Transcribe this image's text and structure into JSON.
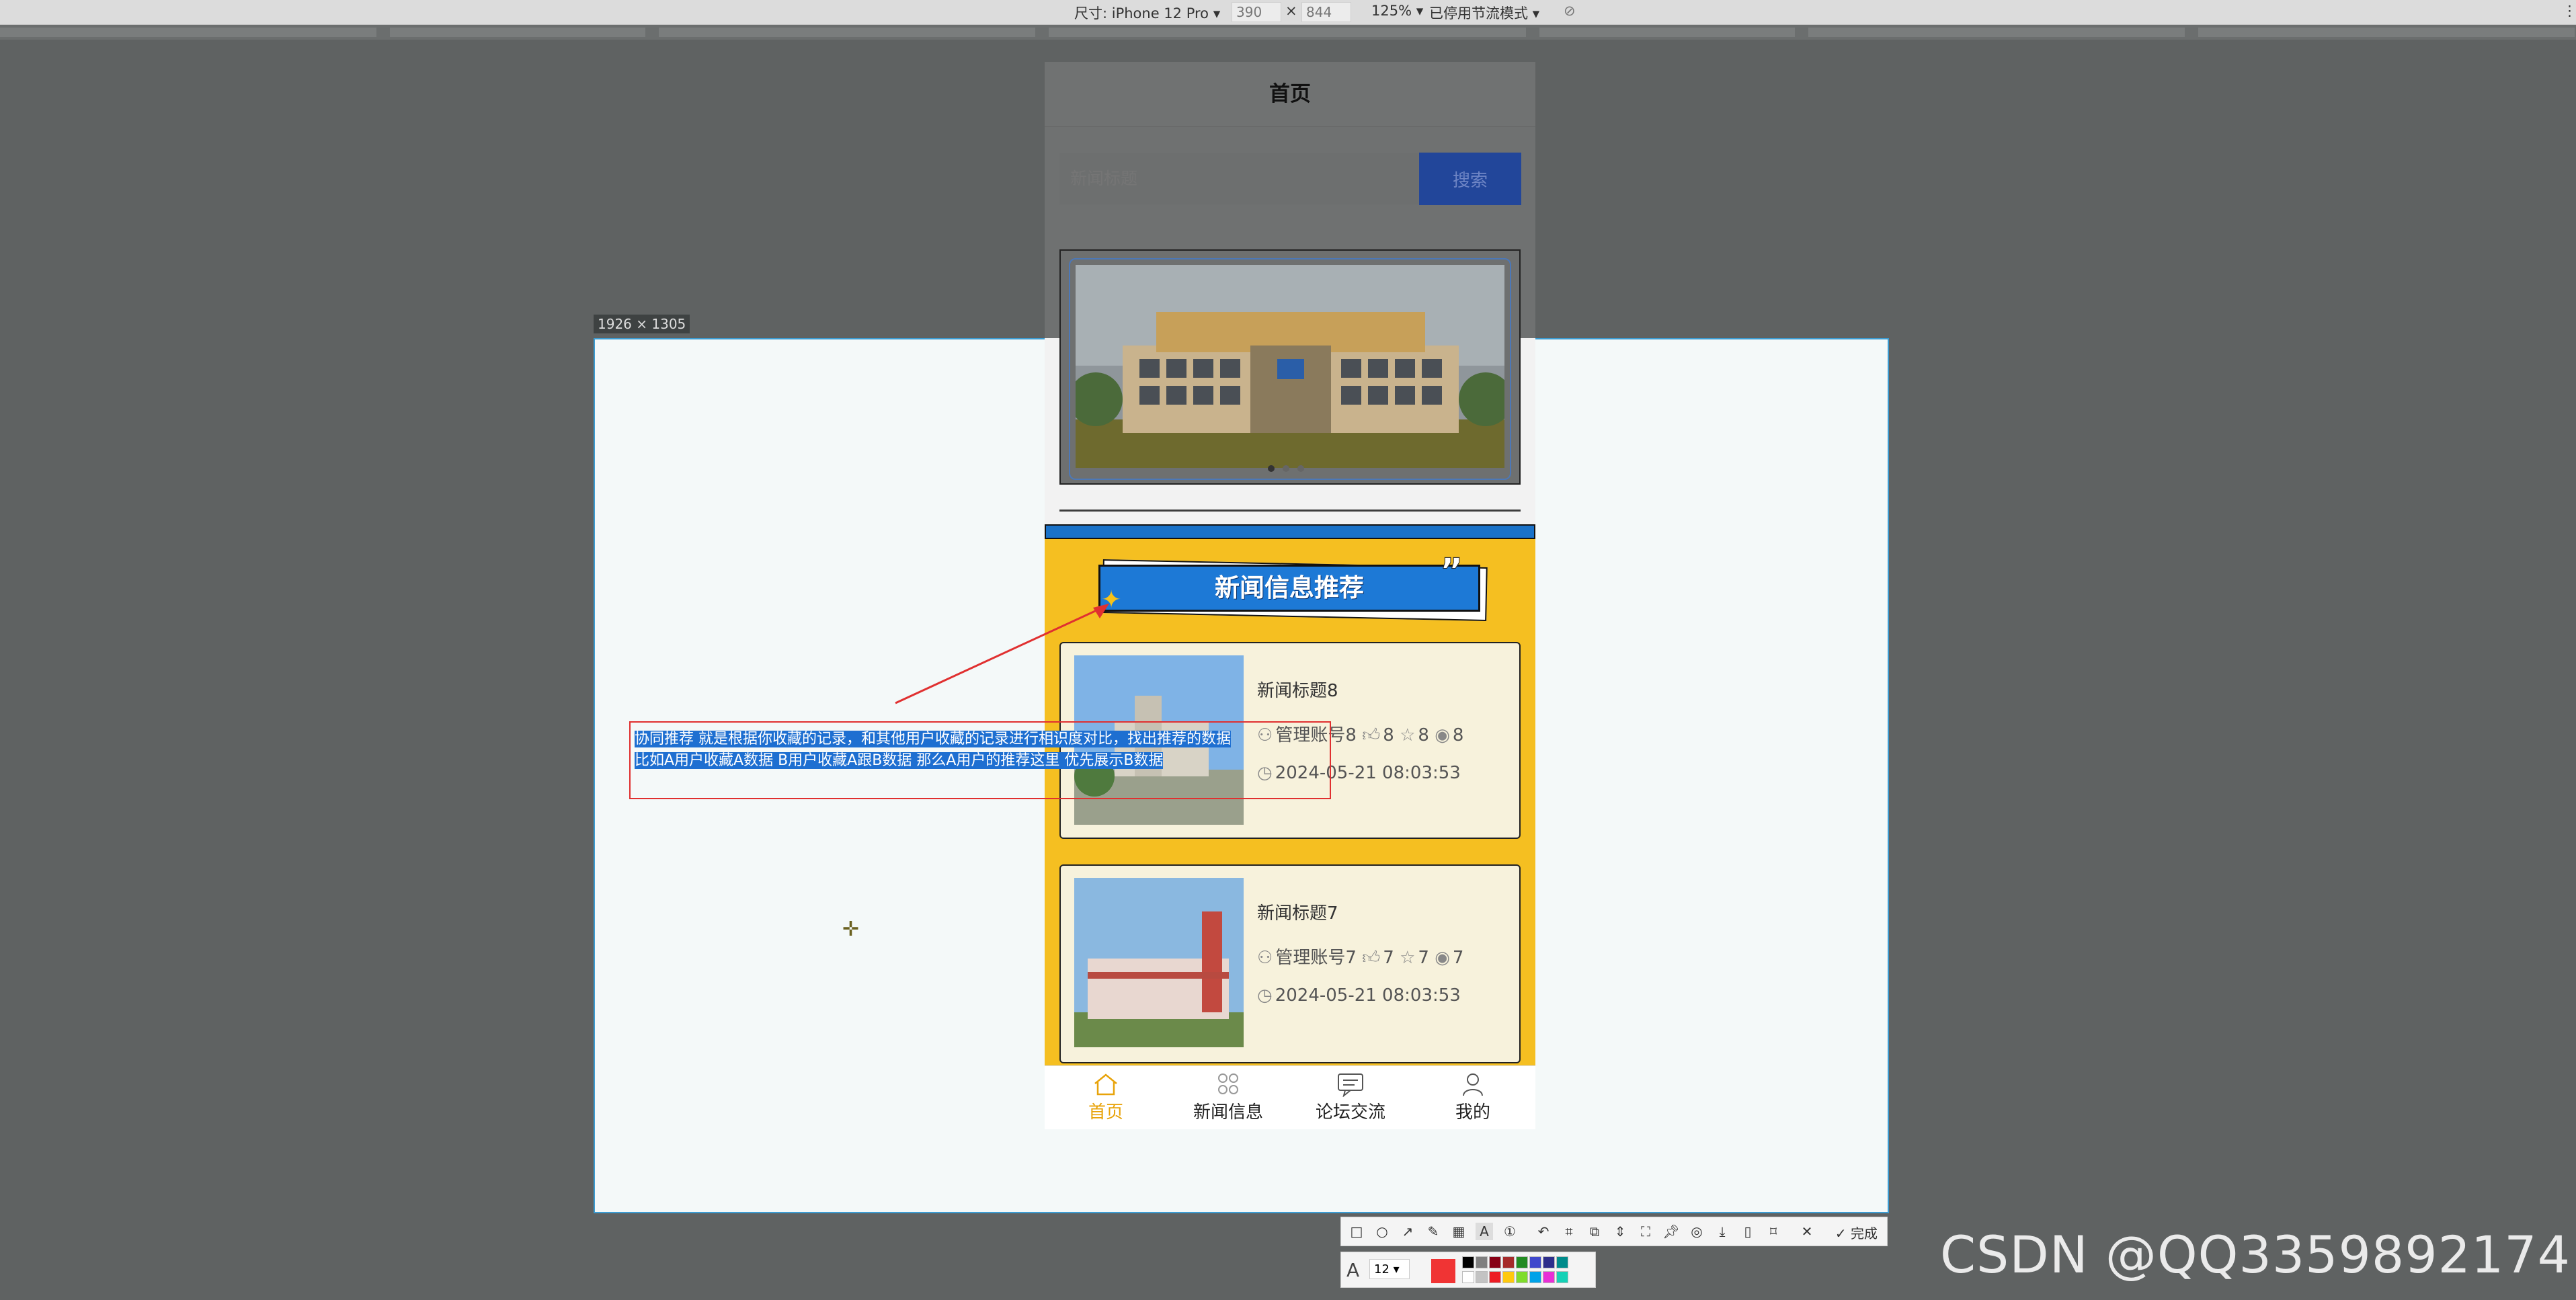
{
  "devtools": {
    "device": "尺寸: iPhone 12 Pro ▾",
    "width": "390",
    "times": "×",
    "height": "844",
    "zoom": "125% ▾",
    "throttle": "已停用节流模式 ▾"
  },
  "selection": {
    "size_label": "1926 × 1305"
  },
  "page": {
    "title": "首页",
    "search": {
      "placeholder": "新闻标题",
      "button": "搜索"
    },
    "recommend_title": "新闻信息推荐",
    "recommend_quote": "”",
    "news": [
      {
        "title": "新闻标题8",
        "author": "管理账号8",
        "likes": "8",
        "favorites": "8",
        "views": "8",
        "time": "2024-05-21 08:03:53"
      },
      {
        "title": "新闻标题7",
        "author": "管理账号7",
        "likes": "7",
        "favorites": "7",
        "views": "7",
        "time": "2024-05-21 08:03:53"
      }
    ],
    "tabs": [
      {
        "label": "首页",
        "icon": "home-icon",
        "active": true
      },
      {
        "label": "新闻信息",
        "icon": "grid-icon",
        "active": false
      },
      {
        "label": "论坛交流",
        "icon": "chat-icon",
        "active": false
      },
      {
        "label": "我的",
        "icon": "user-icon",
        "active": false
      }
    ]
  },
  "annotation": {
    "line1": "协同推荐  就是根据你收藏的记录，和其他用户收藏的记录进行相识度对比，找出推荐的数据",
    "line2": "比如A用户收藏A数据 B用户收藏A跟B数据 那么A用户的推荐这里 优先展示B数据"
  },
  "tool": {
    "font_size": "12",
    "done_label": "完成"
  },
  "watermark": "CSDN @QQ3359892174",
  "colors": {
    "accent": "#f5bf21",
    "blue": "#1d79d6",
    "annotation_red": "#e03030",
    "active_tab": "#e8a30a"
  }
}
